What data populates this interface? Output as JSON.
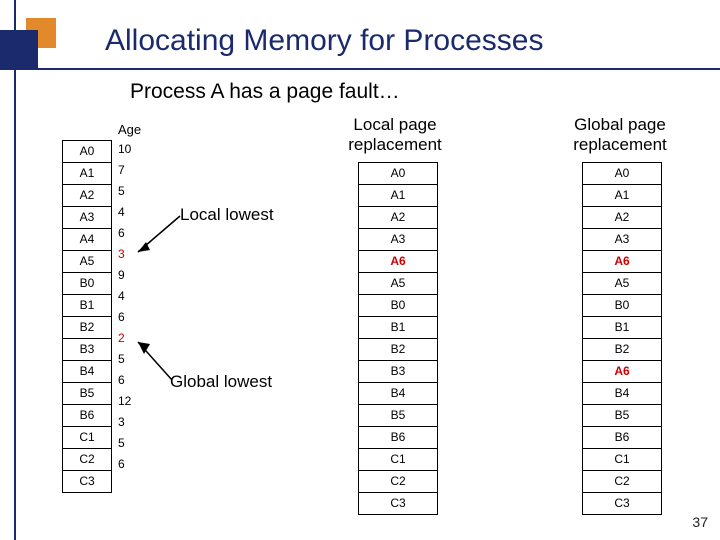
{
  "title": "Allocating Memory for Processes",
  "subtitle": "Process A has a page fault…",
  "pagenum": "37",
  "age_header": "Age",
  "headers": {
    "local": "Local page\nreplacement",
    "global": "Global page\nreplacement"
  },
  "labels": {
    "local_lowest": "Local lowest",
    "global_lowest": "Global lowest"
  },
  "main_stack": [
    {
      "page": "A0",
      "age": "10"
    },
    {
      "page": "A1",
      "age": "7"
    },
    {
      "page": "A2",
      "age": "5"
    },
    {
      "page": "A3",
      "age": "4"
    },
    {
      "page": "A4",
      "age": "6"
    },
    {
      "page": "A5",
      "age": "3",
      "local_lowest": true
    },
    {
      "page": "B0",
      "age": "9"
    },
    {
      "page": "B1",
      "age": "4"
    },
    {
      "page": "B2",
      "age": "6"
    },
    {
      "page": "B3",
      "age": "2",
      "global_lowest": true
    },
    {
      "page": "B4",
      "age": "5"
    },
    {
      "page": "B5",
      "age": "6"
    },
    {
      "page": "B6",
      "age": "12"
    },
    {
      "page": "C1",
      "age": "3"
    },
    {
      "page": "C2",
      "age": "5"
    },
    {
      "page": "C3",
      "age": "6"
    }
  ],
  "local_stack": [
    {
      "page": "A0"
    },
    {
      "page": "A1"
    },
    {
      "page": "A2"
    },
    {
      "page": "A3"
    },
    {
      "page": "A6",
      "hl": true
    },
    {
      "page": "A5"
    },
    {
      "page": "B0"
    },
    {
      "page": "B1"
    },
    {
      "page": "B2"
    },
    {
      "page": "B3"
    },
    {
      "page": "B4"
    },
    {
      "page": "B5"
    },
    {
      "page": "B6"
    },
    {
      "page": "C1"
    },
    {
      "page": "C2"
    },
    {
      "page": "C3"
    }
  ],
  "global_stack": [
    {
      "page": "A0"
    },
    {
      "page": "A1"
    },
    {
      "page": "A2"
    },
    {
      "page": "A3"
    },
    {
      "page": "A6",
      "hl": true
    },
    {
      "page": "A5"
    },
    {
      "page": "B0"
    },
    {
      "page": "B1"
    },
    {
      "page": "B2"
    },
    {
      "page": "A6",
      "hl": true
    },
    {
      "page": "B4"
    },
    {
      "page": "B5"
    },
    {
      "page": "B6"
    },
    {
      "page": "C1"
    },
    {
      "page": "C2"
    },
    {
      "page": "C3"
    }
  ]
}
